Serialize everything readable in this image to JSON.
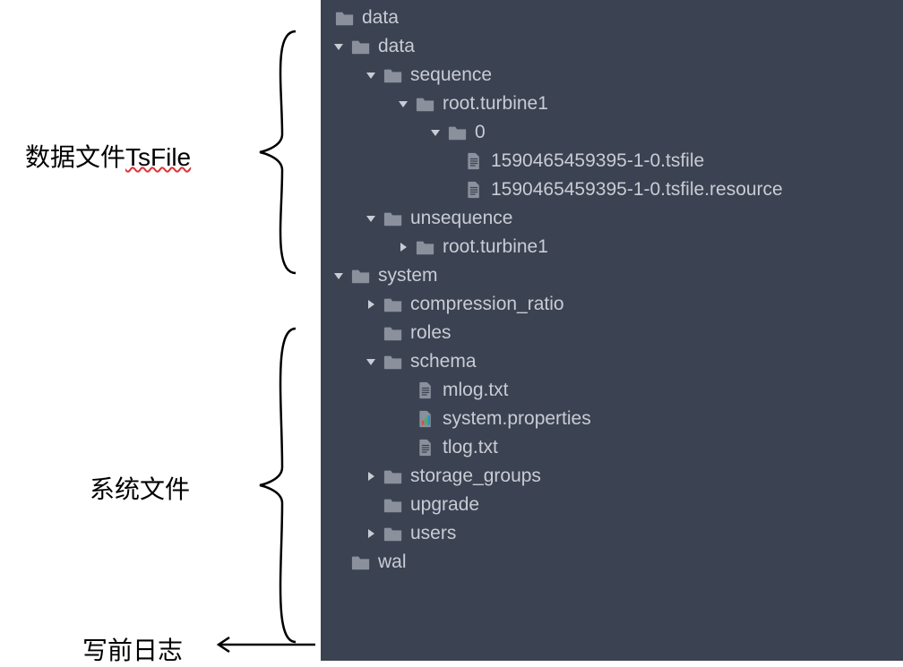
{
  "annotations": {
    "tsfile": {
      "prefix": "数据文件",
      "suffix": "TsFile"
    },
    "system": "系统文件",
    "wal": "写前日志"
  },
  "tree": [
    {
      "depth": 0,
      "arrow": "none",
      "icon": "folder",
      "label": "data"
    },
    {
      "depth": 0,
      "arrow": "down",
      "icon": "folder",
      "label": "data"
    },
    {
      "depth": 1,
      "arrow": "down",
      "icon": "folder",
      "label": "sequence"
    },
    {
      "depth": 2,
      "arrow": "down",
      "icon": "folder",
      "label": "root.turbine1"
    },
    {
      "depth": 3,
      "arrow": "down",
      "icon": "folder",
      "label": "0"
    },
    {
      "depth": 4,
      "arrow": "none",
      "icon": "file",
      "label": "1590465459395-1-0.tsfile"
    },
    {
      "depth": 4,
      "arrow": "none",
      "icon": "file",
      "label": "1590465459395-1-0.tsfile.resource"
    },
    {
      "depth": 1,
      "arrow": "down",
      "icon": "folder",
      "label": "unsequence"
    },
    {
      "depth": 2,
      "arrow": "right",
      "icon": "folder",
      "label": "root.turbine1"
    },
    {
      "depth": 0,
      "arrow": "down",
      "icon": "folder",
      "label": "system"
    },
    {
      "depth": 1,
      "arrow": "right",
      "icon": "folder",
      "label": "compression_ratio"
    },
    {
      "depth": 1,
      "arrow": "none2",
      "icon": "folder",
      "label": "roles"
    },
    {
      "depth": 1,
      "arrow": "down",
      "icon": "folder",
      "label": "schema"
    },
    {
      "depth": 2,
      "arrow": "none2",
      "icon": "file",
      "label": "mlog.txt"
    },
    {
      "depth": 2,
      "arrow": "none2",
      "icon": "props",
      "label": "system.properties"
    },
    {
      "depth": 2,
      "arrow": "none2",
      "icon": "file",
      "label": "tlog.txt"
    },
    {
      "depth": 1,
      "arrow": "right",
      "icon": "folder",
      "label": "storage_groups"
    },
    {
      "depth": 1,
      "arrow": "none2",
      "icon": "folder",
      "label": "upgrade"
    },
    {
      "depth": 1,
      "arrow": "right",
      "icon": "folder",
      "label": "users"
    },
    {
      "depth": 0,
      "arrow": "none2",
      "icon": "folder",
      "label": "wal"
    }
  ],
  "indent_base": 12,
  "indent_step": 36
}
